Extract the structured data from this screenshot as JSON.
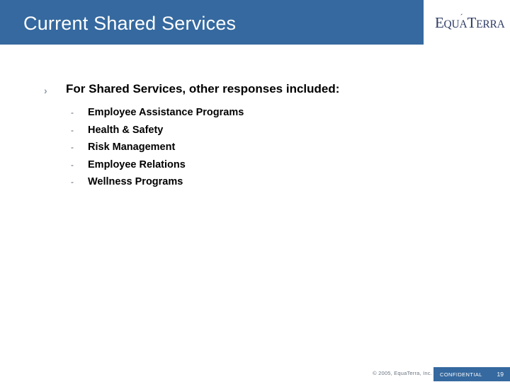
{
  "header": {
    "title": "Current Shared Services",
    "background_color": "#35699f",
    "title_color": "#ffffff"
  },
  "logo": {
    "name": "EquaTerra",
    "part_e": "E",
    "part_qua": "QU",
    "part_a_accent": "A",
    "part_t": "T",
    "part_erra": "ERRA",
    "color": "#2e3b64"
  },
  "main": {
    "bullet": {
      "marker": "chevron-right",
      "marker_glyph": "›",
      "text": "For Shared Services, other responses included:"
    },
    "sub_items": [
      {
        "marker_glyph": "-",
        "text": "Employee Assistance Programs"
      },
      {
        "marker_glyph": "-",
        "text": "Health & Safety"
      },
      {
        "marker_glyph": "-",
        "text": "Risk Management"
      },
      {
        "marker_glyph": "-",
        "text": "Employee Relations"
      },
      {
        "marker_glyph": "-",
        "text": "Wellness Programs"
      }
    ]
  },
  "footer": {
    "copyright": "© 2005, EquaTerra, Inc.",
    "confidential_label": "CONFIDENTIAL",
    "page_number": "19",
    "bar_color": "#35699f"
  }
}
